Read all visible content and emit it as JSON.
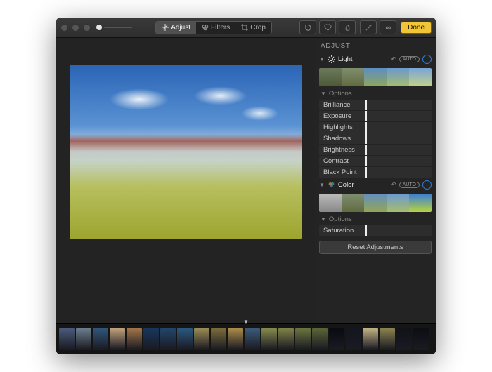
{
  "toolbar": {
    "tabs": {
      "adjust": "Adjust",
      "filters": "Filters",
      "crop": "Crop"
    },
    "done": "Done"
  },
  "sidebar": {
    "title": "ADJUST",
    "sections": {
      "light": {
        "name": "Light",
        "auto": "AUTO",
        "options_label": "Options",
        "sliders": [
          "Brilliance",
          "Exposure",
          "Highlights",
          "Shadows",
          "Brightness",
          "Contrast",
          "Black Point"
        ]
      },
      "color": {
        "name": "Color",
        "auto": "AUTO",
        "options_label": "Options",
        "sliders": [
          "Saturation"
        ]
      }
    },
    "reset": "Reset Adjustments"
  },
  "thumb_count": 22
}
